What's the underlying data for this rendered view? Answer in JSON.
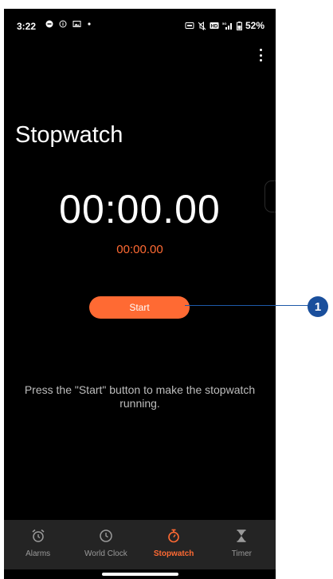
{
  "status_bar": {
    "time": "3:22",
    "battery": "52%",
    "left_icons": [
      "chat-icon",
      "info-icon",
      "gallery-icon",
      "dot-icon"
    ],
    "right_icons": [
      "nfc-icon",
      "mute-icon",
      "hd-icon",
      "signal-icon",
      "battery-icon"
    ]
  },
  "header": {
    "title": "Stopwatch",
    "menu_icon": "more-vert-icon"
  },
  "stopwatch": {
    "main_time": "00:00.00",
    "lap_time": "00:00.00",
    "start_label": "Start",
    "hint": "Press the \"Start\" button to make the stopwatch running."
  },
  "bottom_nav": {
    "items": [
      {
        "label": "Alarms",
        "icon": "alarm-clock-icon",
        "active": false
      },
      {
        "label": "World Clock",
        "icon": "clock-icon",
        "active": false
      },
      {
        "label": "Stopwatch",
        "icon": "stopwatch-icon",
        "active": true
      },
      {
        "label": "Timer",
        "icon": "hourglass-icon",
        "active": false
      }
    ]
  },
  "callout": {
    "number": "1"
  },
  "colors": {
    "accent": "#ff6a33",
    "background": "#000000",
    "nav_background": "#242424",
    "callout": "#1a4f9c"
  }
}
